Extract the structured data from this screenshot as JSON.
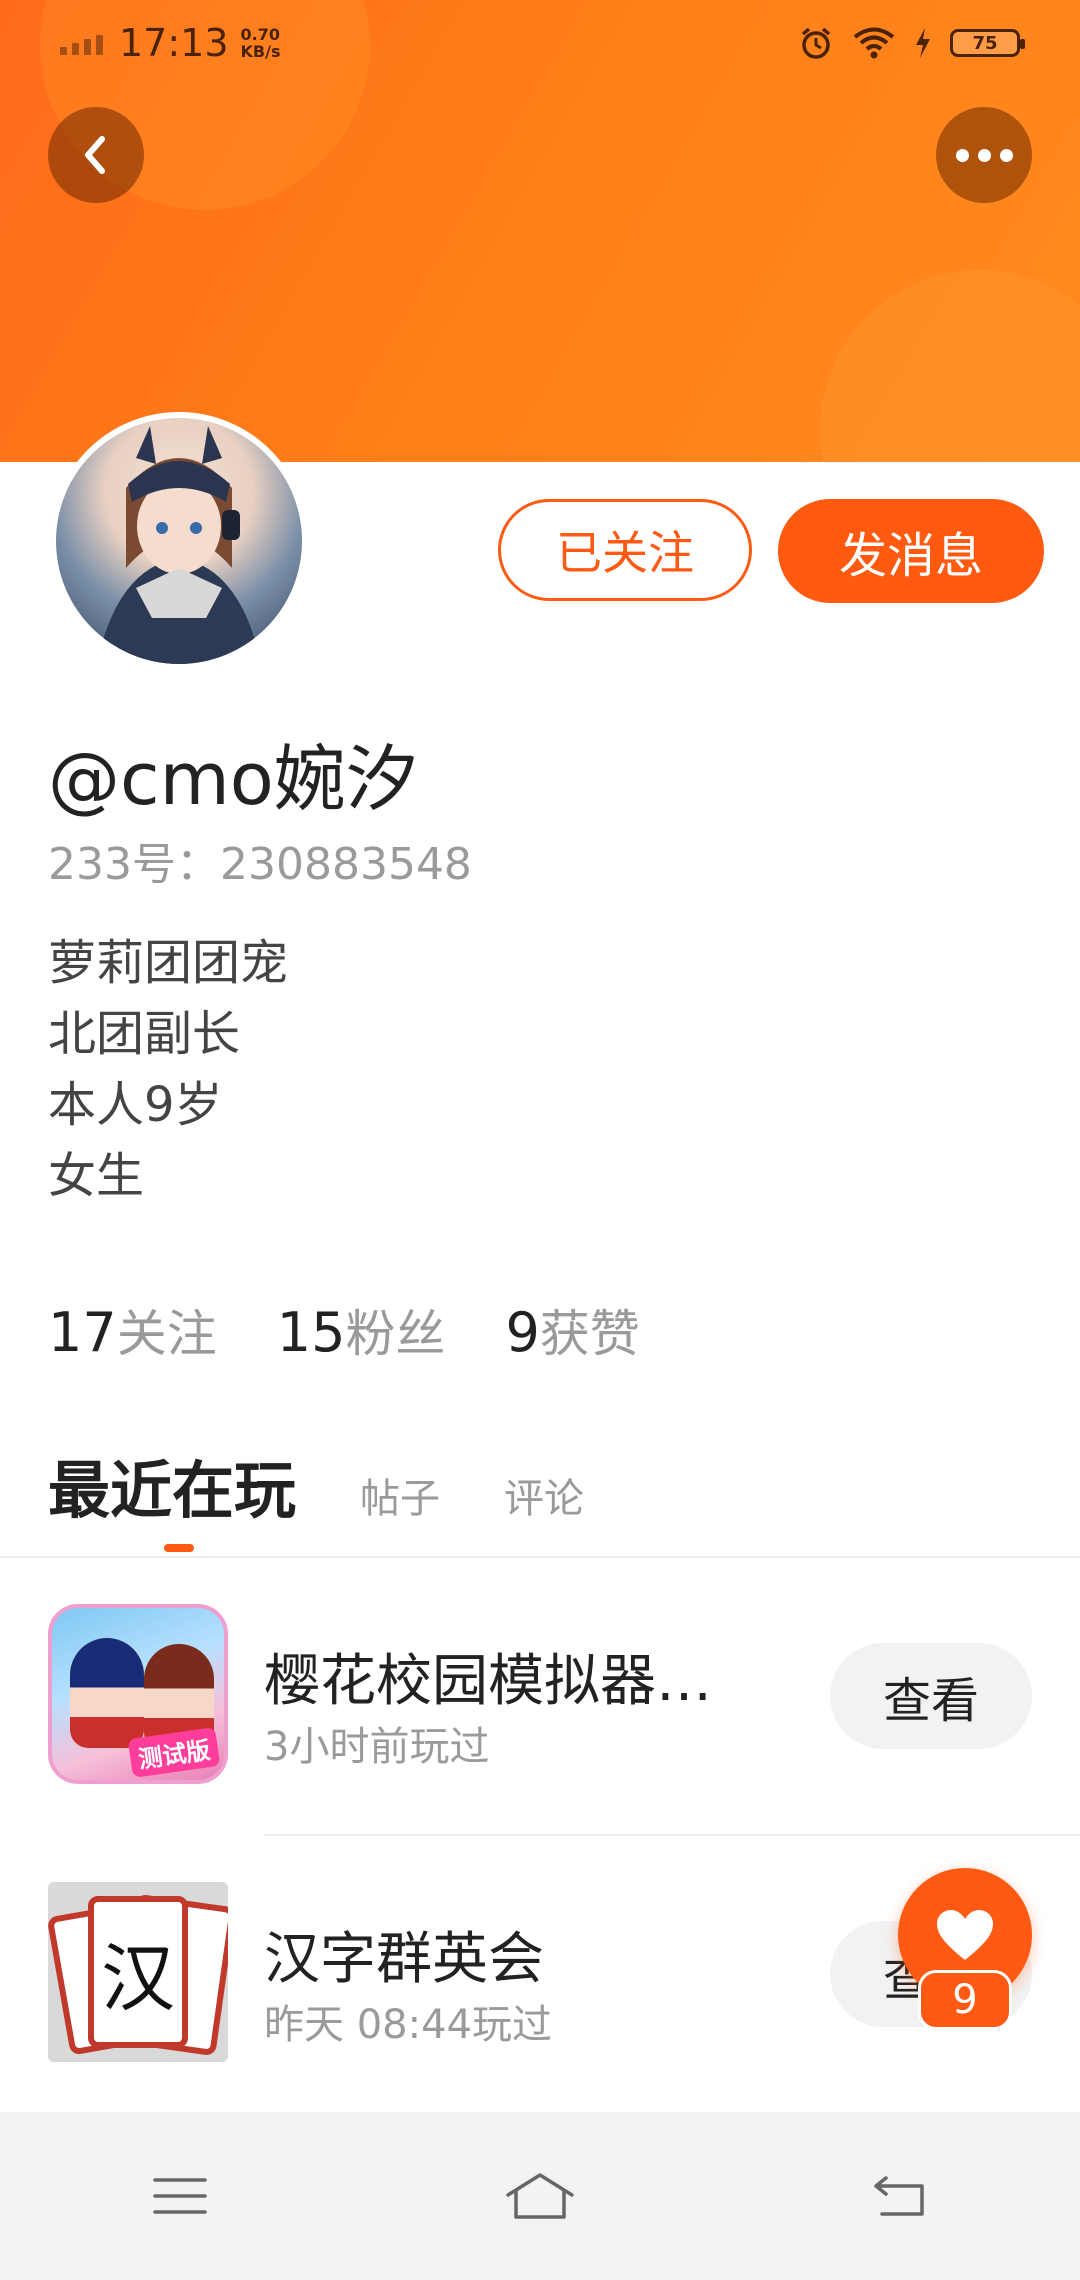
{
  "status_bar": {
    "time": "17:13",
    "speed_value": "0.70",
    "speed_unit": "KB/s",
    "battery": "75",
    "icons": [
      "signal-icon",
      "alarm-icon",
      "wifi-icon",
      "charging-icon",
      "battery-icon"
    ]
  },
  "header": {
    "back_icon": "back-chevron-icon",
    "more_icon": "more-dots-icon",
    "banner_color": "#ff7a1a"
  },
  "profile": {
    "follow_label": "已关注",
    "message_label": "发消息",
    "username": "@cmo婉汐",
    "user_id": "233号：230883548",
    "bio": [
      "萝莉团团宠",
      "北团副长",
      "本人9岁",
      "女生"
    ],
    "stats": [
      {
        "count": "17",
        "label": "关注"
      },
      {
        "count": "15",
        "label": "粉丝"
      },
      {
        "count": "9",
        "label": "获赞"
      }
    ]
  },
  "tabs": [
    {
      "label": "最近在玩",
      "active": true
    },
    {
      "label": "帖子",
      "active": false
    },
    {
      "label": "评论",
      "active": false
    }
  ],
  "games": [
    {
      "title": "樱花校园模拟器…",
      "meta": "3小时前玩过",
      "button": "查看",
      "icon_tag": "测试版"
    },
    {
      "title": "汉字群英会",
      "meta": "昨天 08:44玩过",
      "button": "查看",
      "icon_glyph": "汉"
    }
  ],
  "like_fab": {
    "count": "9"
  },
  "colors": {
    "accent": "#ff5a14",
    "text_primary": "#222222",
    "text_secondary": "#9a9a9a"
  },
  "nav_bar": {
    "icons": [
      "menu-icon",
      "home-icon",
      "back-icon"
    ]
  }
}
